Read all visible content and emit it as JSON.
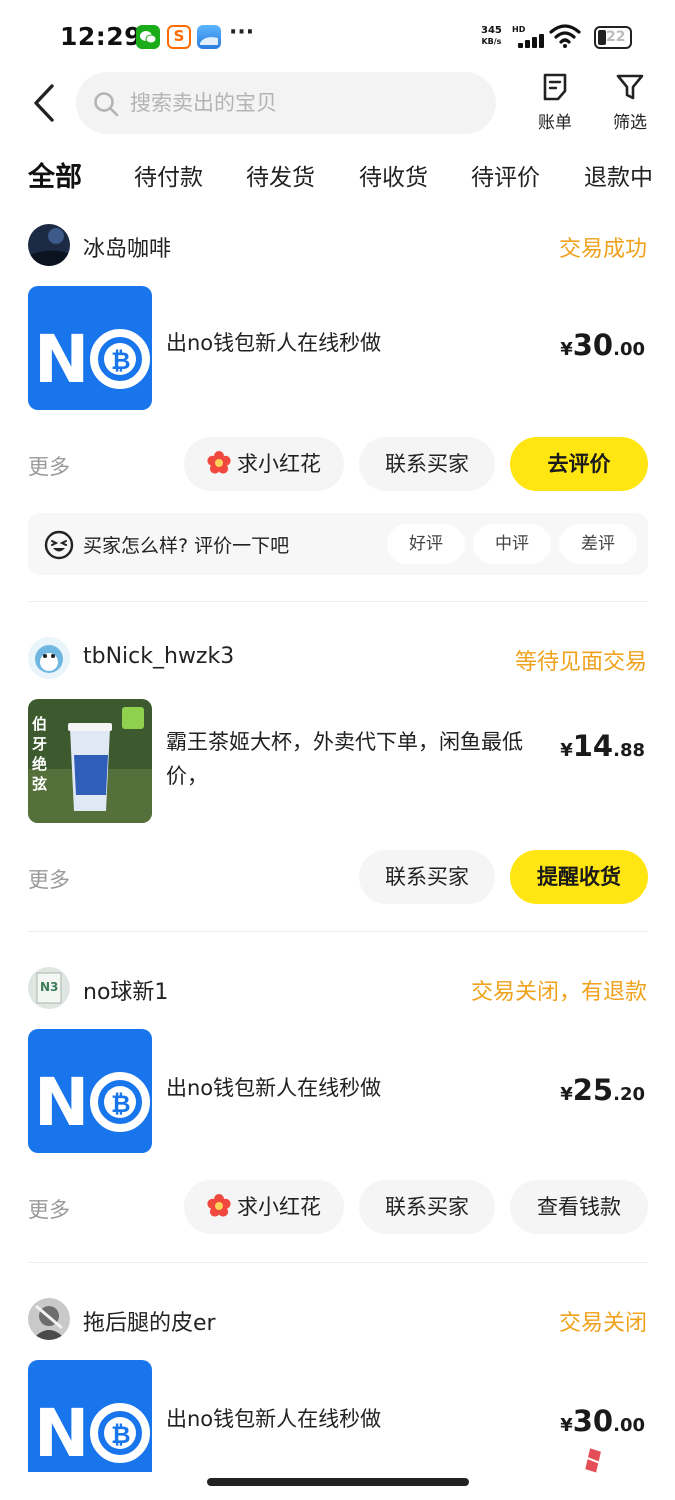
{
  "status_bar": {
    "time": "12:29",
    "dots": "···",
    "net_speed_value": "345",
    "net_speed_unit": "KB/s",
    "hd": "HD",
    "battery": "22",
    "app_icons": [
      "wechat-icon",
      "weibo-icon",
      "cloud-icon"
    ]
  },
  "header": {
    "search_placeholder": "搜索卖出的宝贝",
    "bill_label": "账单",
    "filter_label": "筛选"
  },
  "tabs": [
    {
      "label": "全部",
      "active": true
    },
    {
      "label": "待付款",
      "active": false
    },
    {
      "label": "待发货",
      "active": false
    },
    {
      "label": "待收货",
      "active": false
    },
    {
      "label": "待评价",
      "active": false
    },
    {
      "label": "退款中",
      "active": false
    }
  ],
  "orders": [
    {
      "buyer": "冰岛咖啡",
      "status": "交易成功",
      "title": "出no钱包新人在线秒做",
      "price_symbol": "¥",
      "price_int": "30",
      "price_dec": ".00",
      "more": "更多",
      "flower_button": "求小红花",
      "contact_button": "联系买家",
      "primary_button": "去评价",
      "rating": {
        "prompt": "买家怎么样? 评价一下吧",
        "good": "好评",
        "neutral": "中评",
        "bad": "差评"
      }
    },
    {
      "buyer": "tbNick_hwzk3",
      "status": "等待见面交易",
      "title": "霸王茶姬大杯，外卖代下单，闲鱼最低价，",
      "price_symbol": "¥",
      "price_int": "14",
      "price_dec": ".88",
      "more": "更多",
      "contact_button": "联系买家",
      "primary_button": "提醒收货"
    },
    {
      "buyer": "no球新1",
      "status": "交易关闭，有退款",
      "title": "出no钱包新人在线秒做",
      "price_symbol": "¥",
      "price_int": "25",
      "price_dec": ".20",
      "more": "更多",
      "flower_button": "求小红花",
      "contact_button": "联系买家",
      "secondary_button": "查看钱款"
    },
    {
      "buyer": "拖后腿的皮er",
      "status": "交易关闭",
      "title": "出no钱包新人在线秒做",
      "price_symbol": "¥",
      "price_int": "30",
      "price_dec": ".00"
    }
  ],
  "colors": {
    "accent_yellow": "#ffe512",
    "status_orange": "#f0a21c",
    "product_blue": "#1875ec"
  }
}
